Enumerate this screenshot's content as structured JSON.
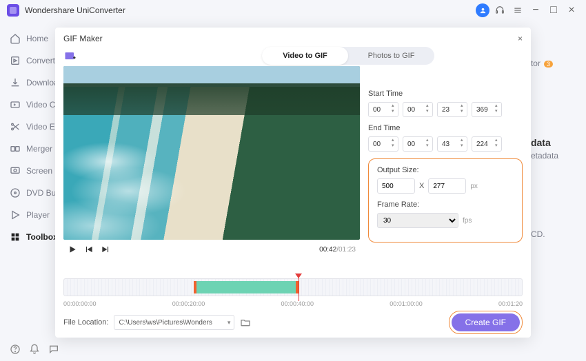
{
  "app": {
    "title": "Wondershare UniConverter"
  },
  "titlebar_icons": {
    "avatar": "user-avatar",
    "headset": "support-icon",
    "menu": "menu-icon",
    "min": "−",
    "max": "□",
    "close": "×"
  },
  "sidebar": {
    "items": [
      {
        "label": "Home"
      },
      {
        "label": "Converter"
      },
      {
        "label": "Downloader"
      },
      {
        "label": "Video Compressor"
      },
      {
        "label": "Video Editor"
      },
      {
        "label": "Merger"
      },
      {
        "label": "Screen Recorder"
      },
      {
        "label": "DVD Burner"
      },
      {
        "label": "Player"
      },
      {
        "label": "Toolbox"
      }
    ]
  },
  "bg": {
    "tor_label": "tor",
    "tor_badge": "3",
    "data_title": "data",
    "data_sub": "etadata",
    "cd": "CD."
  },
  "modal": {
    "title": "GIF Maker",
    "tabs": {
      "video": "Video to GIF",
      "photos": "Photos to GIF"
    },
    "close": "×",
    "player": {
      "current": "00:42",
      "duration": "01:23",
      "sep": "/"
    },
    "start_label": "Start Time",
    "end_label": "End Time",
    "start": {
      "h": "00",
      "m": "00",
      "s": "23",
      "ms": "369"
    },
    "end": {
      "h": "00",
      "m": "00",
      "s": "43",
      "ms": "224"
    },
    "output": {
      "size_label": "Output Size:",
      "w": "500",
      "x": "X",
      "h": "277",
      "unit": "px",
      "rate_label": "Frame Rate:",
      "rate": "30",
      "rate_unit": "fps"
    },
    "ruler": [
      "00:00:00:00",
      "00:00:20:00",
      "00:00:40:00",
      "00:01:00:00",
      "00:01:20"
    ],
    "file_location_label": "File Location:",
    "file_location": "C:\\Users\\ws\\Pictures\\Wonders",
    "create": "Create GIF"
  }
}
